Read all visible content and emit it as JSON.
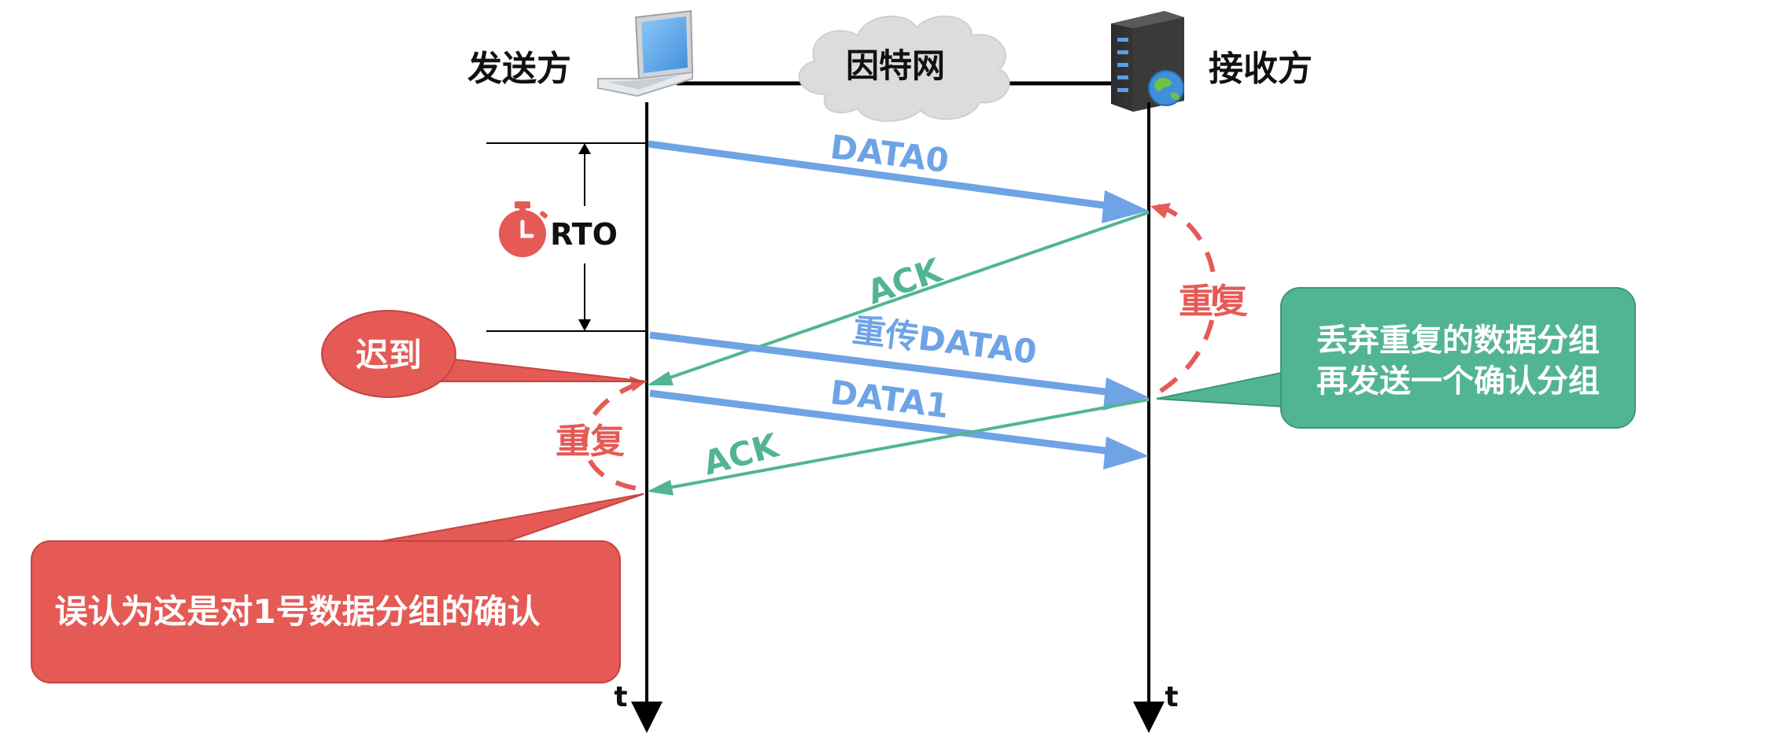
{
  "sender_label": "发送方",
  "receiver_label": "接收方",
  "network_label": "因特网",
  "rto_label": "RTO",
  "messages": {
    "data0": "DATA0",
    "ack1": "ACK",
    "retransmit": "重传DATA0",
    "data1": "DATA1",
    "ack2": "ACK"
  },
  "late_label": "迟到",
  "duplicate_label_receiver": "重复",
  "duplicate_label_sender": "重复",
  "receiver_note": {
    "line1": "丢弃重复的数据分组",
    "line2": "再发送一个确认分组"
  },
  "sender_note": "误认为这是对1号数据分组的确认",
  "time_axis_label_sender": "t",
  "time_axis_label_receiver": "t",
  "colors": {
    "data_arrow": "#6ea3e6",
    "ack_arrow": "#52b592",
    "red": "#e55a55",
    "green_box": "#52b592",
    "black": "#000000"
  }
}
